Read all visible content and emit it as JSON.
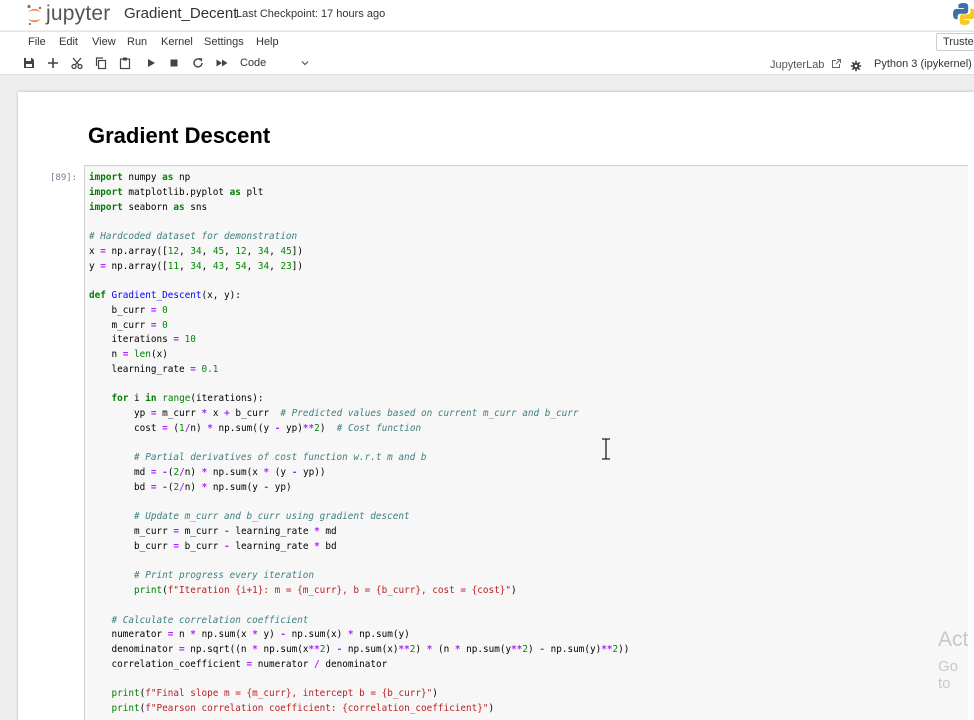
{
  "header": {
    "logo_text": "jupyter",
    "notebook_title": "Gradient_Decent",
    "checkpoint": "Last Checkpoint: 17 hours ago",
    "trusted": "Trusted"
  },
  "menu": [
    "File",
    "Edit",
    "View",
    "Run",
    "Kernel",
    "Settings",
    "Help"
  ],
  "toolbar": {
    "icons": [
      "save-icon",
      "add-cell-icon",
      "cut-icon",
      "copy-icon",
      "paste-icon",
      "run-icon",
      "stop-icon",
      "restart-icon",
      "fast-forward-icon"
    ],
    "cell_type": "Code",
    "jupyterlab_link": "JupyterLab",
    "kernel_name": "Python 3 (ipykernel)"
  },
  "notebook": {
    "heading": "Gradient Descent",
    "prompt": "[89]:",
    "code_lines": [
      "import numpy as np",
      "import matplotlib.pyplot as plt",
      "import seaborn as sns",
      "",
      "# Hardcoded dataset for demonstration",
      "x = np.array([12, 34, 45, 12, 34, 45])",
      "y = np.array([11, 34, 43, 54, 34, 23])",
      "",
      "def Gradient_Descent(x, y):",
      "    b_curr = 0",
      "    m_curr = 0",
      "    iterations = 10",
      "    n = len(x)",
      "    learning_rate = 0.1",
      "",
      "    for i in range(iterations):",
      "        yp = m_curr * x + b_curr  # Predicted values based on current m_curr and b_curr",
      "        cost = (1/n) * np.sum((y - yp)**2)  # Cost function",
      "",
      "        # Partial derivatives of cost function w.r.t m and b",
      "        md = -(2/n) * np.sum(x * (y - yp))",
      "        bd = -(2/n) * np.sum(y - yp)",
      "",
      "        # Update m_curr and b_curr using gradient descent",
      "        m_curr = m_curr - learning_rate * md",
      "        b_curr = b_curr - learning_rate * bd",
      "",
      "        # Print progress every iteration",
      "        print(f\"Iteration {i+1}: m = {m_curr}, b = {b_curr}, cost = {cost}\")",
      "",
      "    # Calculate correlation coefficient",
      "    numerator = n * np.sum(x * y) - np.sum(x) * np.sum(y)",
      "    denominator = np.sqrt((n * np.sum(x**2) - np.sum(x)**2) * (n * np.sum(y**2) - np.sum(y)**2))",
      "    correlation_coefficient = numerator / denominator",
      "",
      "    print(f\"Final slope m = {m_curr}, intercept b = {b_curr}\")",
      "    print(f\"Pearson correlation coefficient: {correlation_coefficient}\")"
    ]
  },
  "watermark": {
    "line1": "Act",
    "line2": "Go to"
  }
}
